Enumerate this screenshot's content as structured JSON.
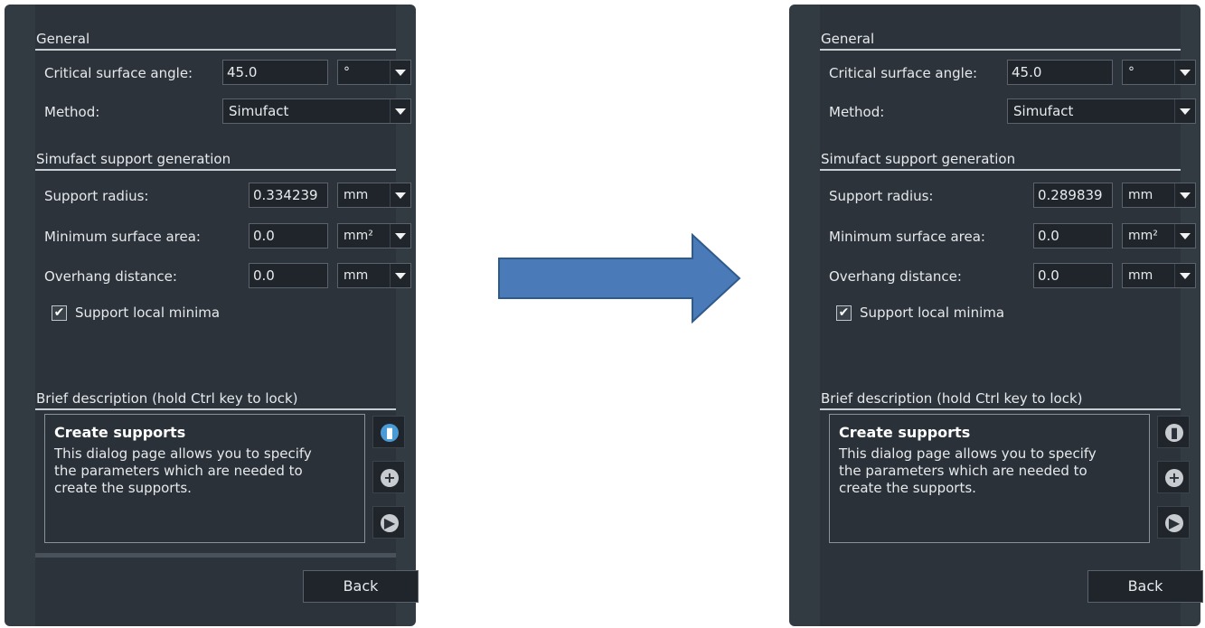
{
  "left_panel": {
    "general_title": "General",
    "critical_angle_label": "Critical surface angle:",
    "critical_angle_value": "45.0",
    "angle_unit": "°",
    "method_label": "Method:",
    "method_value": "Simufact",
    "support_title": "Simufact support generation",
    "support_radius_label": "Support radius:",
    "support_radius_value": "0.334239",
    "support_radius_unit": "mm",
    "min_area_label": "Minimum surface area:",
    "min_area_value": "0.0",
    "min_area_unit": "mm²",
    "overhang_label": "Overhang distance:",
    "overhang_value": "0.0",
    "overhang_unit": "mm",
    "local_minima_label": "Support local minima",
    "local_minima_checked": true,
    "brief_title": "Brief description (hold Ctrl key to lock)",
    "desc_heading": "Create supports",
    "desc_body": "This dialog page allows you to specify the parameters which are needed to create the supports.",
    "back_label": "Back"
  },
  "right_panel": {
    "general_title": "General",
    "critical_angle_label": "Critical surface angle:",
    "critical_angle_value": "45.0",
    "angle_unit": "°",
    "method_label": "Method:",
    "method_value": "Simufact",
    "support_title": "Simufact support generation",
    "support_radius_label": "Support radius:",
    "support_radius_value": "0.289839",
    "support_radius_unit": "mm",
    "min_area_label": "Minimum surface area:",
    "min_area_value": "0.0",
    "min_area_unit": "mm²",
    "overhang_label": "Overhang distance:",
    "overhang_value": "0.0",
    "overhang_unit": "mm",
    "local_minima_label": "Support local minima",
    "local_minima_checked": true,
    "brief_title": "Brief description (hold Ctrl key to lock)",
    "desc_heading": "Create supports",
    "desc_body": "This dialog page allows you to specify the parameters which are needed to create the supports.",
    "back_label": "Back"
  },
  "colors": {
    "arrow": "#4a7ab8",
    "arrow_border": "#2f5a8c",
    "panel_bg": "#323a42",
    "icon_active": "#4a9ad6"
  },
  "icons": {
    "save": "save-icon",
    "add": "plus-icon",
    "next": "play-icon",
    "arrow": "right-arrow"
  }
}
